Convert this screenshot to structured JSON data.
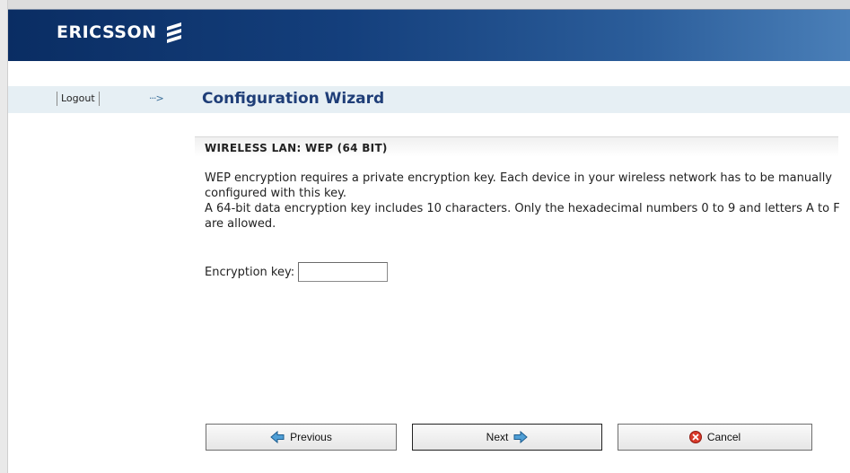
{
  "header": {
    "brand": "ERICSSON",
    "logo_icon": "ericsson-stripes-icon"
  },
  "nav": {
    "logout_label": "Logout",
    "arrow_glyph": "···>",
    "page_title": "Configuration Wizard"
  },
  "section": {
    "title": "WIRELESS LAN: WEP (64 BIT)",
    "description_lines": [
      "WEP encryption requires a private encryption key. Each device in your wireless network has to be manually configured with this key.",
      "A 64-bit data encryption key includes 10 characters. Only the hexadecimal numbers 0 to 9 and letters A to F are allowed."
    ]
  },
  "form": {
    "encryption_key_label": "Encryption key:",
    "encryption_key_value": ""
  },
  "buttons": {
    "previous_label": "Previous",
    "previous_icon": "arrow-left-icon",
    "next_label": "Next",
    "next_icon": "arrow-right-icon",
    "cancel_label": "Cancel",
    "cancel_icon": "cancel-x-icon"
  },
  "colors": {
    "header_dark": "#0a2d63",
    "header_light": "#4a7fb8",
    "title_blue": "#1f3e78",
    "nav_bg": "#e6eff4",
    "arrow_icon": "#4f9fd6",
    "cancel_icon": "#d93a2b"
  }
}
